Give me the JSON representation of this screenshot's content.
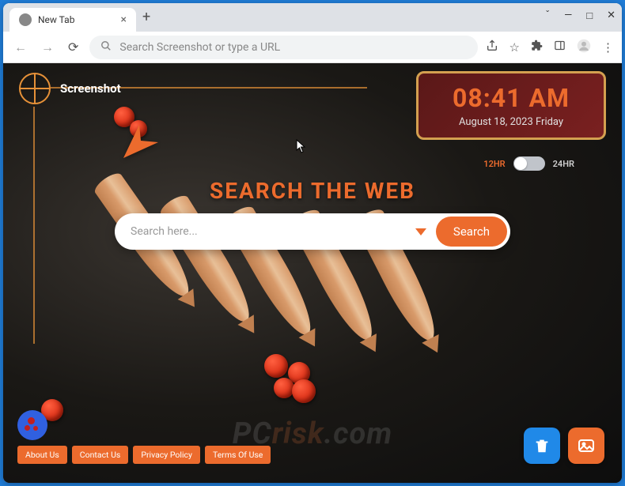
{
  "window": {
    "tab_title": "New Tab",
    "minimize_icon": "—",
    "maximize_icon": "□",
    "close_icon": "✕"
  },
  "toolbar": {
    "omnibox_placeholder": "Search Screenshot or type a URL"
  },
  "brand": {
    "name": "Screenshot"
  },
  "clock": {
    "time": "08:41 AM",
    "date": "August 18, 2023  Friday",
    "label_12": "12HR",
    "label_24": "24HR"
  },
  "main": {
    "title": "SEARCH THE WEB",
    "search_placeholder": "Search here...",
    "search_button": "Search"
  },
  "footer": {
    "links": [
      "About Us",
      "Contact Us",
      "Privacy Policy",
      "Terms Of Use"
    ]
  },
  "watermark": {
    "prefix": "PC",
    "suffix": "risk",
    "domain": ".com"
  }
}
